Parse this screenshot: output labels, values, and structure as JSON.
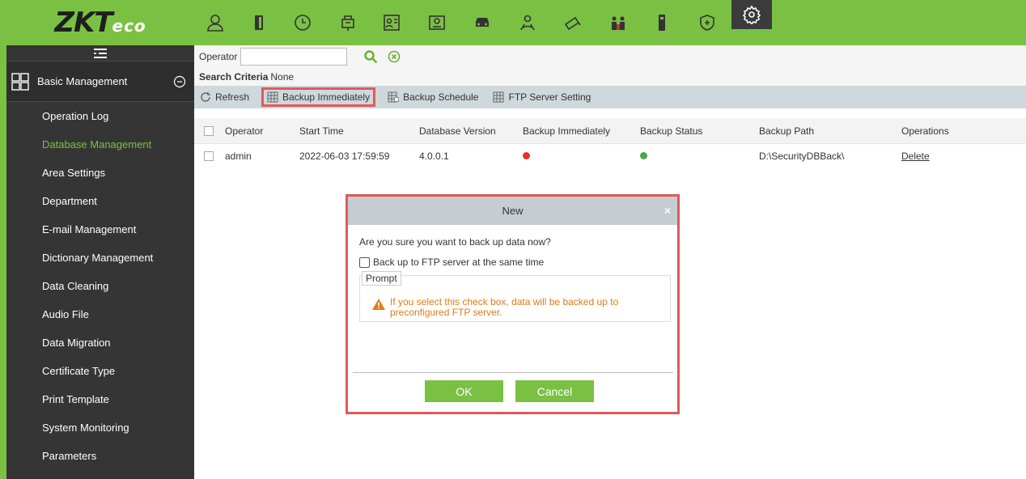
{
  "colors": {
    "brand_green": "#7ac143",
    "sidebar_bg": "#353535",
    "highlight_red": "#e05a5a",
    "warning_orange": "#e07b1a",
    "status_error": "#e8312f",
    "status_ok": "#4ca84a"
  },
  "header": {
    "logo_main": "ZKT",
    "logo_sub": "eco",
    "icons": [
      "personnel-icon",
      "access-door-icon",
      "time-attendance-icon",
      "elevator-icon",
      "visitor-icon",
      "consumption-icon",
      "parking-icon",
      "patrol-icon",
      "video-icon",
      "office-icon",
      "intrusion-icon",
      "security-shield-icon",
      "system-settings-icon"
    ]
  },
  "sidebar": {
    "module_title": "Basic Management",
    "items": [
      {
        "label": "Operation Log"
      },
      {
        "label": "Database Management"
      },
      {
        "label": "Area Settings"
      },
      {
        "label": "Department"
      },
      {
        "label": "E-mail Management"
      },
      {
        "label": "Dictionary Management"
      },
      {
        "label": "Data Cleaning"
      },
      {
        "label": "Audio File"
      },
      {
        "label": "Data Migration"
      },
      {
        "label": "Certificate Type"
      },
      {
        "label": "Print Template"
      },
      {
        "label": "System Monitoring"
      },
      {
        "label": "Parameters"
      }
    ],
    "active_index": 1
  },
  "search": {
    "label": "Operator",
    "value": ""
  },
  "criteria": {
    "label": "Search Criteria",
    "value": "None"
  },
  "toolbar": {
    "refresh": "Refresh",
    "backup_immediately": "Backup Immediately",
    "backup_schedule": "Backup Schedule",
    "ftp_setting": "FTP Server Setting"
  },
  "table": {
    "columns": [
      "Operator",
      "Start Time",
      "Database Version",
      "Backup Immediately",
      "Backup Status",
      "Backup Path",
      "Operations"
    ],
    "rows": [
      {
        "operator": "admin",
        "start_time": "2022-06-03 17:59:59",
        "db_version": "4.0.0.1",
        "backup_immediately": "error",
        "backup_status": "ok",
        "backup_path": "D:\\SecurityDBBack\\",
        "operation": "Delete"
      }
    ]
  },
  "dialog": {
    "title": "New",
    "close": "×",
    "message": "Are you sure you want to back up data now?",
    "checkbox_label": "Back up to FTP server at the same time",
    "prompt_title": "Prompt",
    "prompt_line1": "If you select this check box, data will be backed up to",
    "prompt_line2": "preconfigured FTP server.",
    "ok": "OK",
    "cancel": "Cancel"
  }
}
